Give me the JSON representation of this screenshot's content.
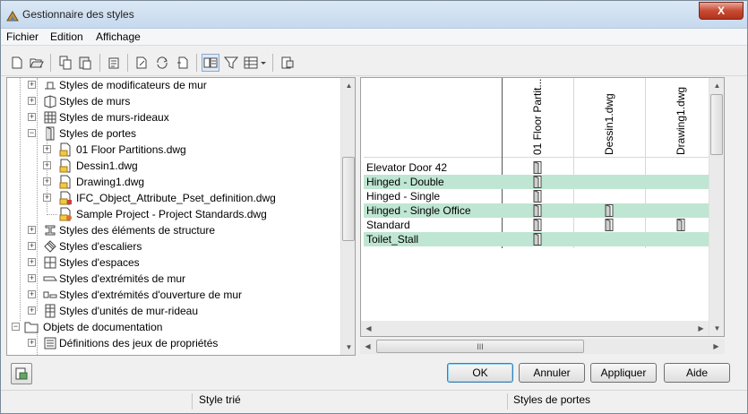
{
  "window": {
    "title": "Gestionnaire des styles",
    "close_label": "X"
  },
  "menu": {
    "items": [
      {
        "label": "Fichier"
      },
      {
        "label": "Edition"
      },
      {
        "label": "Affichage"
      }
    ]
  },
  "toolbar": {
    "icons": [
      "new-icon",
      "open-icon",
      "copy-icon",
      "paste-icon",
      "purge-icon",
      "edit-style-icon",
      "synchronize-icon",
      "style-set-icon",
      "toggle-view-icon",
      "filter-icon",
      "view-options-icon",
      "inspect-icon"
    ]
  },
  "tree": {
    "items": [
      {
        "label": "Styles de modificateurs de mur",
        "icon": "wall-modifier-icon"
      },
      {
        "label": "Styles de murs",
        "icon": "wall-style-icon"
      },
      {
        "label": "Styles de murs-rideaux",
        "icon": "curtain-wall-icon"
      },
      {
        "label": "Styles de portes",
        "icon": "door-style-icon"
      },
      {
        "label": "01 Floor Partitions.dwg",
        "icon": "dwg-file-icon"
      },
      {
        "label": "Dessin1.dwg",
        "icon": "dwg-file-icon"
      },
      {
        "label": "Drawing1.dwg",
        "icon": "dwg-file-icon"
      },
      {
        "label": "IFC_Object_Attribute_Pset_definition.dwg",
        "icon": "dwg-file-icon"
      },
      {
        "label": "Sample Project - Project Standards.dwg",
        "icon": "dwg-project-icon"
      },
      {
        "label": "Styles des éléments de structure",
        "icon": "structural-member-icon"
      },
      {
        "label": "Styles d'escaliers",
        "icon": "stair-icon"
      },
      {
        "label": "Styles d'espaces",
        "icon": "space-icon"
      },
      {
        "label": "Styles d'extrémités de mur",
        "icon": "wall-endcap-icon"
      },
      {
        "label": "Styles d'extrémités d'ouverture de mur",
        "icon": "opening-endcap-icon"
      },
      {
        "label": "Styles d'unités de mur-rideau",
        "icon": "curtain-unit-icon"
      },
      {
        "label": "Objets de documentation",
        "icon": "folder-icon"
      },
      {
        "label": "Définitions des jeux de propriétés",
        "icon": "property-set-icon"
      }
    ]
  },
  "grid": {
    "columns": [
      "01 Floor Partit...",
      "Dessin1.dwg",
      "Drawing1.dwg"
    ],
    "rows": [
      {
        "label": "Elevator Door 42",
        "cells": [
          true,
          false,
          false
        ]
      },
      {
        "label": "Hinged - Double",
        "cells": [
          true,
          false,
          false
        ]
      },
      {
        "label": "Hinged - Single",
        "cells": [
          true,
          false,
          false
        ]
      },
      {
        "label": "Hinged - Single Office",
        "cells": [
          true,
          true,
          false
        ]
      },
      {
        "label": "Standard",
        "cells": [
          true,
          true,
          true
        ]
      },
      {
        "label": "Toilet_Stall",
        "cells": [
          true,
          false,
          false
        ]
      }
    ],
    "hscroll_grip": "III"
  },
  "buttons": {
    "ok": "OK",
    "cancel": "Annuler",
    "apply": "Appliquer",
    "help": "Aide"
  },
  "status": {
    "left": "Style trié",
    "right": "Styles de portes"
  },
  "colors": {
    "highlight_row": "#bfe6d2"
  }
}
